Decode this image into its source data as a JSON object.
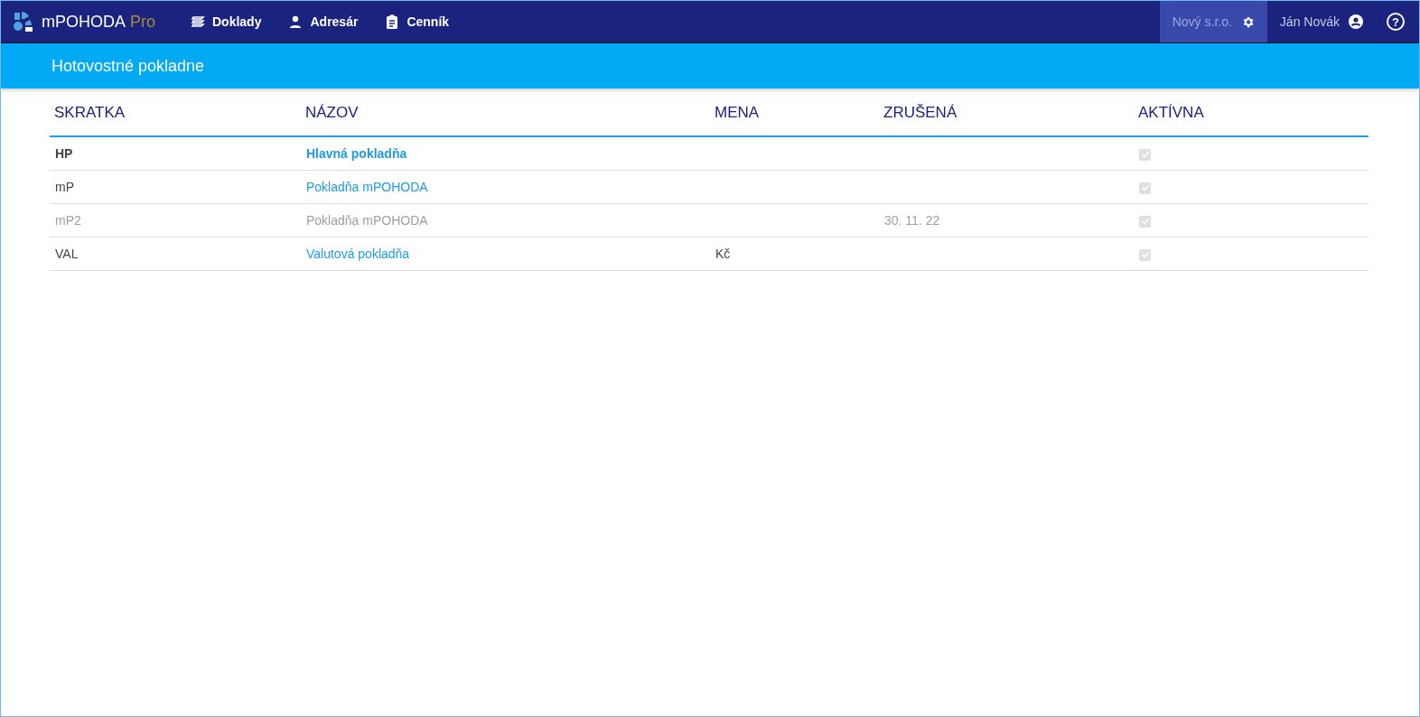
{
  "app": {
    "name": "mPOHODA",
    "edition": "Pro"
  },
  "nav": [
    {
      "label": "Doklady"
    },
    {
      "label": "Adresár"
    },
    {
      "label": "Cenník"
    }
  ],
  "company": "Nový s.r.o.",
  "user": "Ján Novák",
  "help": "?",
  "page_title": "Hotovostné pokladne",
  "table": {
    "columns": [
      "SKRATKA",
      "NÁZOV",
      "MENA",
      "ZRUŠENÁ",
      "AKTÍVNA"
    ],
    "rows": [
      {
        "code": "HP",
        "name": "Hlavná pokladňa",
        "active": true,
        "bold": true,
        "disabled": false
      },
      {
        "code": "mP",
        "name": "Pokladňa mPOHODA",
        "active": true,
        "bold": false,
        "disabled": false
      },
      {
        "code": "mP2",
        "name": "Pokladňa mPOHODA",
        "cancelled": "30. 11. 22",
        "active": true,
        "bold": false,
        "disabled": true
      },
      {
        "code": "VAL",
        "name": "Valutová pokladňa",
        "currency": "Kč",
        "active": true,
        "bold": false,
        "disabled": false
      }
    ]
  }
}
